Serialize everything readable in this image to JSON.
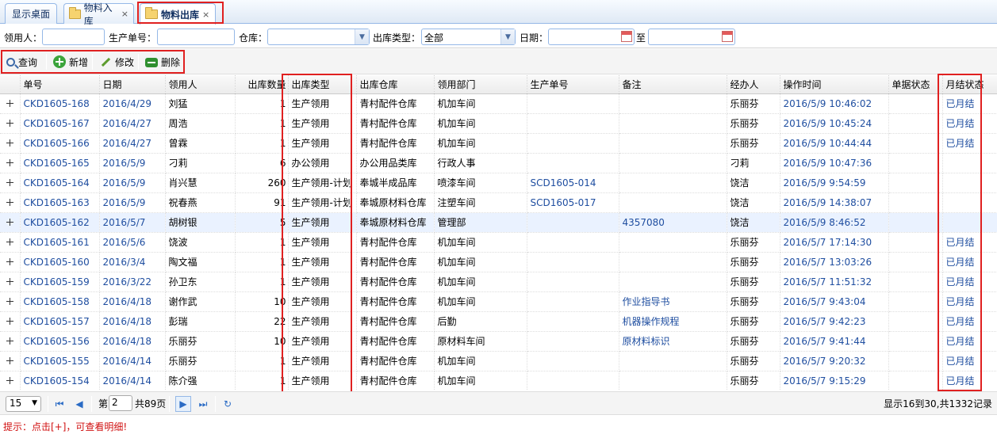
{
  "tabs": [
    {
      "label": "显示桌面"
    },
    {
      "label": "物料入库",
      "close": "×"
    },
    {
      "label": "物料出库",
      "close": "×"
    }
  ],
  "filter": {
    "receiver_label": "领用人：",
    "receiver_value": "",
    "prod_no_label": "生产单号：",
    "prod_no_value": "",
    "warehouse_label": "仓库：",
    "warehouse_value": "",
    "out_type_label": "出库类型：",
    "out_type_value": "全部",
    "date_label": "日期：",
    "date_from": "",
    "to_label": "至",
    "date_to": ""
  },
  "toolbar": {
    "query": "查询",
    "add": "新增",
    "edit": "修改",
    "delete": "删除"
  },
  "columns": [
    "单号",
    "日期",
    "领用人",
    "出库数量",
    "出库类型",
    "出库仓库",
    "领用部门",
    "生产单号",
    "备注",
    "经办人",
    "操作时间",
    "单据状态",
    "月结状态"
  ],
  "rows": [
    {
      "no": "CKD1605-168",
      "date": "2016/4/29",
      "recv": "刘猛",
      "qty": "1",
      "type": "生产领用",
      "wh": "青村配件仓库",
      "dept": "机加车间",
      "prod": "",
      "memo": "",
      "op": "乐丽芬",
      "time": "2016/5/9 10:46:02",
      "status": "",
      "month": "已月结"
    },
    {
      "no": "CKD1605-167",
      "date": "2016/4/27",
      "recv": "周浩",
      "qty": "1",
      "type": "生产领用",
      "wh": "青村配件仓库",
      "dept": "机加车间",
      "prod": "",
      "memo": "",
      "op": "乐丽芬",
      "time": "2016/5/9 10:45:24",
      "status": "",
      "month": "已月结"
    },
    {
      "no": "CKD1605-166",
      "date": "2016/4/27",
      "recv": "曾霖",
      "qty": "1",
      "type": "生产领用",
      "wh": "青村配件仓库",
      "dept": "机加车间",
      "prod": "",
      "memo": "",
      "op": "乐丽芬",
      "time": "2016/5/9 10:44:44",
      "status": "",
      "month": "已月结"
    },
    {
      "no": "CKD1605-165",
      "date": "2016/5/9",
      "recv": "刁莉",
      "qty": "6",
      "type": "办公领用",
      "wh": "办公用品类库",
      "dept": "行政人事",
      "prod": "",
      "memo": "",
      "op": "刁莉",
      "time": "2016/5/9 10:47:36",
      "status": "",
      "month": ""
    },
    {
      "no": "CKD1605-164",
      "date": "2016/5/9",
      "recv": "肖兴慧",
      "qty": "260",
      "type": "生产领用-计划",
      "wh": "奉城半成品库",
      "dept": "喷漆车间",
      "prod": "SCD1605-014",
      "memo": "",
      "op": "饶洁",
      "time": "2016/5/9 9:54:59",
      "status": "",
      "month": ""
    },
    {
      "no": "CKD1605-163",
      "date": "2016/5/9",
      "recv": "祝春燕",
      "qty": "91",
      "type": "生产领用-计划",
      "wh": "奉城原材料仓库",
      "dept": "注塑车间",
      "prod": "SCD1605-017",
      "memo": "",
      "op": "饶洁",
      "time": "2016/5/9 14:38:07",
      "status": "",
      "month": ""
    },
    {
      "no": "CKD1605-162",
      "date": "2016/5/7",
      "recv": "胡树银",
      "qty": "5",
      "type": "生产领用",
      "wh": "奉城原材料仓库",
      "dept": "管理部",
      "prod": "",
      "memo": "4357080",
      "op": "饶洁",
      "time": "2016/5/9 8:46:52",
      "status": "",
      "month": ""
    },
    {
      "no": "CKD1605-161",
      "date": "2016/5/6",
      "recv": "饶波",
      "qty": "1",
      "type": "生产领用",
      "wh": "青村配件仓库",
      "dept": "机加车间",
      "prod": "",
      "memo": "",
      "op": "乐丽芬",
      "time": "2016/5/7 17:14:30",
      "status": "",
      "month": "已月结"
    },
    {
      "no": "CKD1605-160",
      "date": "2016/3/4",
      "recv": "陶文福",
      "qty": "1",
      "type": "生产领用",
      "wh": "青村配件仓库",
      "dept": "机加车间",
      "prod": "",
      "memo": "",
      "op": "乐丽芬",
      "time": "2016/5/7 13:03:26",
      "status": "",
      "month": "已月结"
    },
    {
      "no": "CKD1605-159",
      "date": "2016/3/22",
      "recv": "孙卫东",
      "qty": "1",
      "type": "生产领用",
      "wh": "青村配件仓库",
      "dept": "机加车间",
      "prod": "",
      "memo": "",
      "op": "乐丽芬",
      "time": "2016/5/7 11:51:32",
      "status": "",
      "month": "已月结"
    },
    {
      "no": "CKD1605-158",
      "date": "2016/4/18",
      "recv": "谢作武",
      "qty": "10",
      "type": "生产领用",
      "wh": "青村配件仓库",
      "dept": "机加车间",
      "prod": "",
      "memo": "作业指导书",
      "op": "乐丽芬",
      "time": "2016/5/7 9:43:04",
      "status": "",
      "month": "已月结"
    },
    {
      "no": "CKD1605-157",
      "date": "2016/4/18",
      "recv": "彭瑞",
      "qty": "22",
      "type": "生产领用",
      "wh": "青村配件仓库",
      "dept": "后勤",
      "prod": "",
      "memo": "机器操作规程",
      "op": "乐丽芬",
      "time": "2016/5/7 9:42:23",
      "status": "",
      "month": "已月结"
    },
    {
      "no": "CKD1605-156",
      "date": "2016/4/18",
      "recv": "乐丽芬",
      "qty": "10",
      "type": "生产领用",
      "wh": "青村配件仓库",
      "dept": "原材料车间",
      "prod": "",
      "memo": "原材料标识",
      "op": "乐丽芬",
      "time": "2016/5/7 9:41:44",
      "status": "",
      "month": "已月结"
    },
    {
      "no": "CKD1605-155",
      "date": "2016/4/14",
      "recv": "乐丽芬",
      "qty": "1",
      "type": "生产领用",
      "wh": "青村配件仓库",
      "dept": "机加车间",
      "prod": "",
      "memo": "",
      "op": "乐丽芬",
      "time": "2016/5/7 9:20:32",
      "status": "",
      "month": "已月结"
    },
    {
      "no": "CKD1605-154",
      "date": "2016/4/14",
      "recv": "陈介强",
      "qty": "1",
      "type": "生产领用",
      "wh": "青村配件仓库",
      "dept": "机加车间",
      "prod": "",
      "memo": "",
      "op": "乐丽芬",
      "time": "2016/5/7 9:15:29",
      "status": "",
      "month": "已月结"
    }
  ],
  "pager": {
    "page_size": "15",
    "page_prefix": "第",
    "page_value": "2",
    "page_total": "共89页",
    "summary": "显示16到30,共1332记录"
  },
  "hint": "提示：点击[+]，可查看明细!",
  "colors": {
    "link_blue": "#1f4ea0",
    "highlight_red": "#e02020",
    "border_blue": "#95b8e7"
  }
}
